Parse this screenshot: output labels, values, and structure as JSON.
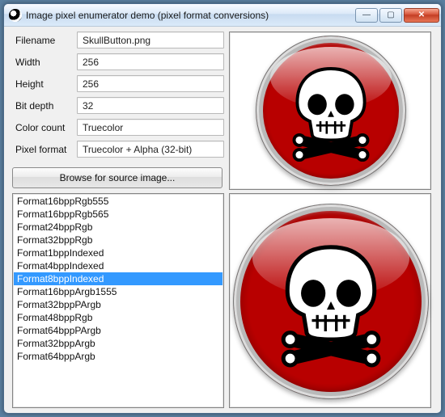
{
  "window": {
    "title": "Image pixel enumerator demo (pixel format conversions)",
    "icon": "yin-yang-icon"
  },
  "properties": {
    "filename_label": "Filename",
    "filename_value": "SkullButton.png",
    "width_label": "Width",
    "width_value": "256",
    "height_label": "Height",
    "height_value": "256",
    "bitdepth_label": "Bit depth",
    "bitdepth_value": "32",
    "colorcount_label": "Color count",
    "colorcount_value": "Truecolor",
    "pixelformat_label": "Pixel format",
    "pixelformat_value": "Truecolor + Alpha (32-bit)"
  },
  "browse_button": "Browse for source image...",
  "formats": {
    "items": [
      "Format16bppRgb555",
      "Format16bppRgb565",
      "Format24bppRgb",
      "Format32bppRgb",
      "Format1bppIndexed",
      "Format4bppIndexed",
      "Format8bppIndexed",
      "Format16bppArgb1555",
      "Format32bppPArgb",
      "Format48bppRgb",
      "Format64bppPArgb",
      "Format32bppArgb",
      "Format64bppArgb"
    ],
    "selected_index": 6
  },
  "win_controls": {
    "minimize": "—",
    "maximize": "▢",
    "close": "✕"
  }
}
